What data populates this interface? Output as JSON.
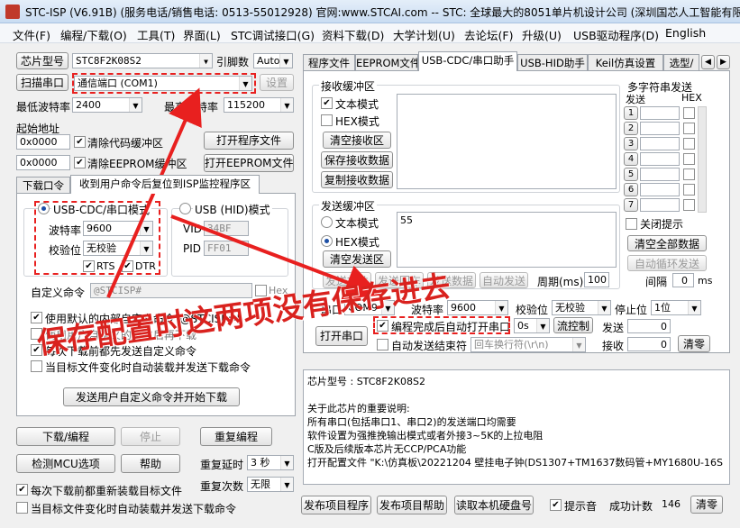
{
  "window": {
    "title": "STC-ISP (V6.91B) (服务电话/销售电话: 0513-55012928) 官网:www.STCAI.com  -- STC: 全球最大的8051单片机设计公司 (深圳国芯人工智能有限公司)"
  },
  "menu": [
    "文件(F)",
    "编程/下载(O)",
    "工具(T)",
    "界面(L)",
    "STC调试接口(G)",
    "资料下载(D)",
    "大学计划(U)",
    "去论坛(F)",
    "升级(U)",
    "USB驱动程序(D)",
    "English"
  ],
  "left": {
    "chip_btn": "芯片型号",
    "chip_value": "STC8F2K08S2",
    "pins_label": "引脚数",
    "pins_value": "Auto",
    "scan_btn": "扫描串口",
    "port_value": "通信端口 (COM1)",
    "settings_btn": "设置",
    "min_baud_label": "最低波特率",
    "min_baud_value": "2400",
    "max_baud_label": "最高波特率",
    "max_baud_value": "115200",
    "start_addr_label": "起始地址",
    "addr1": "0x0000",
    "clear_code_label": "清除代码缓冲区",
    "open_prog_btn": "打开程序文件",
    "addr2": "0x0000",
    "clear_eeprom_label": "清除EEPROM缓冲区",
    "open_eeprom_btn": "打开EEPROM文件",
    "tabs": [
      "下载口令",
      "收到用户命令后复位到ISP监控程序区"
    ],
    "usb_cdc_label": "USB-CDC/串口模式",
    "usb_hid_label": "USB (HID)模式",
    "baud_label": "波特率",
    "baud_value": "9600",
    "parity_label": "校验位",
    "parity_value": "无校验",
    "rts_label": "RTS",
    "dtr_label": "DTR",
    "vid_label": "VID",
    "vid_value": "34BF",
    "pid_label": "PID",
    "pid_value": "FF01",
    "custom_cmd_label": "自定义命令",
    "custom_cmd_value": "@STCISP#",
    "hex_label": "Hex",
    "chk_default": "使用默认的内部自定义命令\"@STCISP#\"",
    "chk_hidden": "使用用户自定义的复位后再下载",
    "chk_each": "每次下载前都先发送自定义命令",
    "chk_target": "当目标文件变化时自动装载并发送下载命令",
    "send_custom_btn": "发送用户自定义命令并开始下载",
    "download_btn": "下载/编程",
    "stop_btn": "停止",
    "reprog_btn": "重复编程",
    "detect_btn": "检测MCU选项",
    "help_btn": "帮助",
    "repeat_delay_label": "重复延时",
    "repeat_delay_value": "3 秒",
    "repeat_count_label": "重复次数",
    "repeat_count_value": "无限",
    "chk_reload": "每次下载前都重新装载目标文件",
    "chk_autoload": "当目标文件变化时自动装载并发送下载命令"
  },
  "right": {
    "tabs": [
      "程序文件",
      "EEPROM文件",
      "USB-CDC/串口助手",
      "USB-HID助手",
      "Keil仿真设置",
      "选型/"
    ],
    "recv_title": "接收缓冲区",
    "recv_text_mode": "文本模式",
    "recv_hex_mode": "HEX模式",
    "clear_recv_btn": "清空接收区",
    "save_recv_btn": "保存接收数据",
    "copy_recv_btn": "复制接收数据",
    "send_title": "发送缓冲区",
    "send_text_mode": "文本模式",
    "send_hex_mode": "HEX模式",
    "send_value": "55",
    "clear_send_btn": "清空发送区",
    "send_file_btn": "发送文件",
    "send_enter_btn": "发送回车",
    "send_data_btn": "发送数据",
    "auto_send_btn": "自动发送",
    "period_label": "周期(ms)",
    "period_value": "100",
    "multi_title": "多字符串发送",
    "col_send": "发送",
    "col_hex": "HEX",
    "multi_rows": [
      "1",
      "2",
      "3",
      "4",
      "5",
      "6",
      "7"
    ],
    "close_tip_label": "关闭提示",
    "clear_all_btn": "清空全部数据",
    "auto_loop_btn": "自动循环发送",
    "interval_label": "间隔",
    "interval_value": "0",
    "interval_unit": "ms",
    "port_label": "串口",
    "port_value": "COM9",
    "baud_label": "波特率",
    "baud_value": "9600",
    "parity_label": "校验位",
    "parity_value": "无校验",
    "stop_label": "停止位",
    "stop_value": "1位",
    "open_port_btn": "打开串口",
    "chk_auto_open": "编程完成后自动打开串口",
    "auto_open_value": "0s",
    "flow_btn": "流控制",
    "send_count_label": "发送",
    "send_count_value": "0",
    "chk_auto_end": "自动发送结束符",
    "newline_value": "回车换行符(\\r\\n)",
    "recv_count_label": "接收",
    "recv_count_value": "0",
    "clear_count_btn": "清零",
    "info_lines": [
      "芯片型号 : STC8F2K08S2",
      "",
      "关于此芯片的重要说明:",
      "    所有串口(包括串口1、串口2)的发送端口均需要",
      "          软件设置为强推挽输出模式或者外接3~5K的上拉电阻",
      "    C版及后续版本芯片无CCP/PCA功能",
      "打开配置文件 \"K:\\仿真板\\20221204 壁挂电子钟(DS1307+TM1637数码管+MY1680U-16S"
    ],
    "publish_prog_btn": "发布项目程序",
    "publish_help_btn": "发布项目帮助",
    "read_disk_btn": "读取本机硬盘号",
    "chk_tip_sound": "提示音",
    "success_label": "成功计数",
    "success_value": "146",
    "clear_success_btn": "清零"
  },
  "annotation": {
    "text": "保存配置时这两项没有保存进去",
    "color": "#d9221e"
  }
}
